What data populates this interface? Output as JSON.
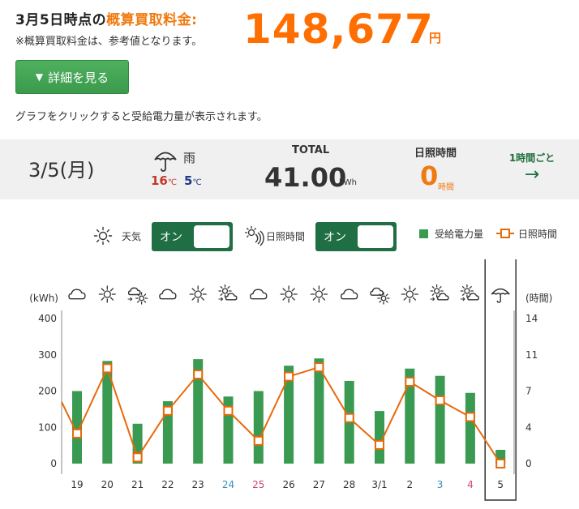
{
  "header": {
    "title_prefix": "3月5日時点の",
    "title_highlight": "概算買取料金:",
    "note": "※概算買取料金は、参考値となります。",
    "amount": "148,677",
    "unit": "円"
  },
  "detail_button": {
    "arrow": "▼",
    "label": "詳細を見る"
  },
  "hint": "グラフをクリックすると受給電力量が表示されます。",
  "summary": {
    "date": "3/5(月)",
    "weather_icon": "umbrella-icon",
    "weather_label": "雨",
    "temp_high": "16",
    "temp_low": "5",
    "temp_unit": "℃",
    "total_label": "TOTAL",
    "total_value": "41.00",
    "total_unit": "kWh",
    "sunshine_label": "日照時間",
    "sunshine_value": "0",
    "sunshine_unit": "時間",
    "hourly_link": "1時間ごと",
    "hourly_arrow": "→"
  },
  "legend": {
    "weather_label": "天気",
    "weather_toggle": "オン",
    "sunshine_label": "日照時間",
    "sunshine_toggle": "オン",
    "bar_label": "受給電力量",
    "line_label": "日照時間"
  },
  "colors": {
    "bar": "#3a9a52",
    "line": "#e8690a",
    "saturday": "#3a8fb5",
    "sunday": "#d0427a",
    "amount": "#ff6e00"
  },
  "chart_data": {
    "type": "bar",
    "left_axis_label": "(kWh)",
    "right_axis_label": "(時間)",
    "ylim": [
      0,
      400
    ],
    "yticks": [
      "400",
      "300",
      "200",
      "100",
      "0"
    ],
    "y2lim": [
      0,
      14
    ],
    "y2ticks": [
      "14",
      "11",
      "7",
      "4",
      "0"
    ],
    "categories": [
      "19",
      "20",
      "21",
      "22",
      "23",
      "24",
      "25",
      "26",
      "27",
      "28",
      "3/1",
      "2",
      "3",
      "4",
      "5"
    ],
    "category_colors": [
      "",
      "",
      "",
      "",
      "",
      "saturday",
      "sunday",
      "",
      "",
      "",
      "",
      "",
      "saturday",
      "sunday",
      ""
    ],
    "weather": [
      "cloud-icon",
      "sun-icon",
      "sun-rain-icon",
      "cloud-icon",
      "sun-icon",
      "sun-cloud-icon",
      "cloud-icon",
      "sun-icon",
      "sun-icon",
      "cloud-icon",
      "cloud-sun-icon",
      "sun-icon",
      "sun-cloud-icon",
      "sun-cloud-icon",
      "umbrella-icon"
    ],
    "series": [
      {
        "name": "受給電力量",
        "type": "bar",
        "values": [
          200,
          283,
          110,
          172,
          288,
          185,
          200,
          270,
          290,
          228,
          145,
          262,
          242,
          195,
          38
        ]
      },
      {
        "name": "日照時間",
        "type": "line",
        "values": [
          2.9,
          9.2,
          0.6,
          5.1,
          8.6,
          5.1,
          2.2,
          8.4,
          9.3,
          4.4,
          1.8,
          7.9,
          6.1,
          4.5,
          0
        ]
      }
    ],
    "selected_index": 14,
    "grid": false
  }
}
